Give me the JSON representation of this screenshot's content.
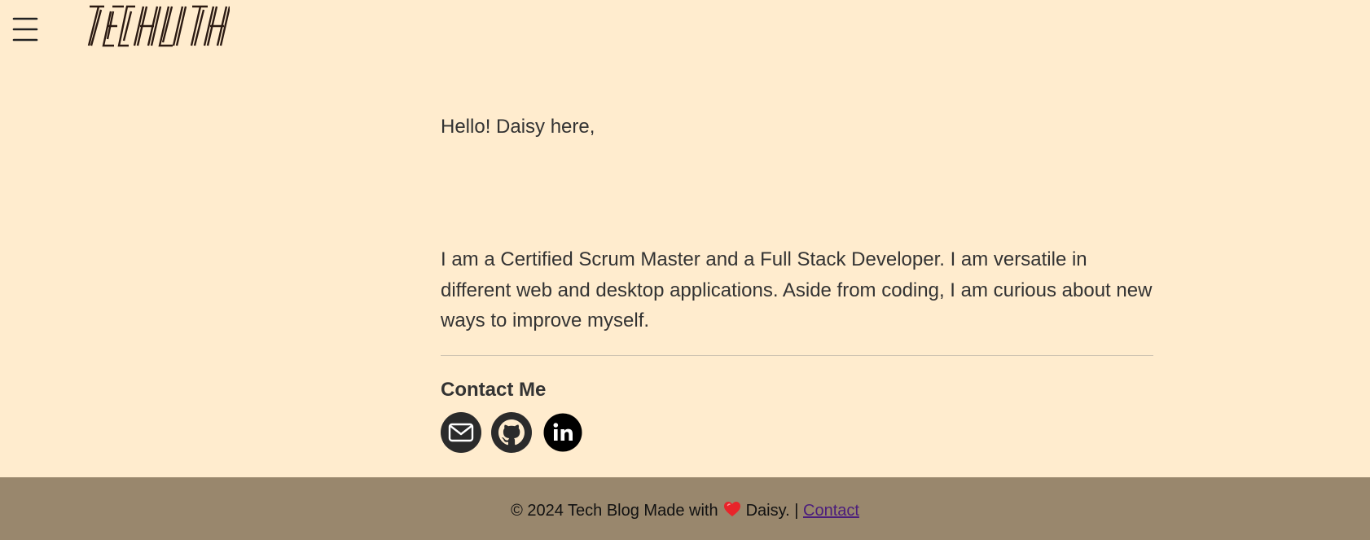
{
  "header": {
    "menu_icon": "hamburger-menu-icon",
    "logo_text": "TECHLITH"
  },
  "main": {
    "greeting": "Hello! Daisy here,",
    "bio": "I am a Certified Scrum Master and a Full Stack Developer. I am versatile in different web and desktop applications. Aside from coding, I am curious about new ways to improve myself.",
    "contact_heading": "Contact Me",
    "social_links": [
      {
        "name": "email",
        "icon": "envelope-icon"
      },
      {
        "name": "github",
        "icon": "github-icon"
      },
      {
        "name": "linkedin",
        "icon": "linkedin-icon"
      }
    ]
  },
  "footer": {
    "copyright_prefix": "© 2024 Tech Blog Made with",
    "heart_icon": "heart-icon",
    "author_suffix": "Daisy. |",
    "link_label": "Contact"
  },
  "colors": {
    "background": "#ffecce",
    "footer_background": "#99876d",
    "text": "#333333",
    "link": "#4b1d7c",
    "heart": "#e8242a"
  }
}
